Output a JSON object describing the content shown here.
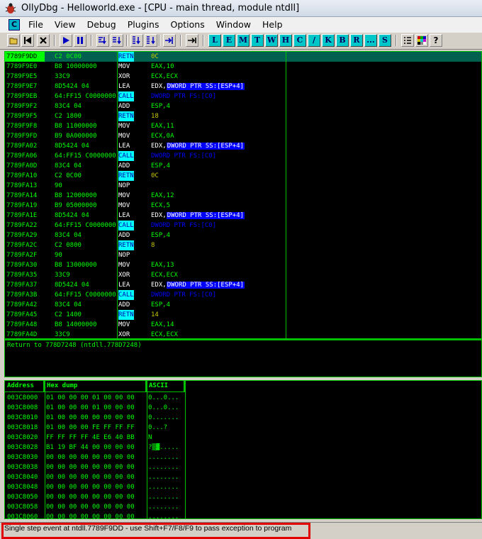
{
  "window": {
    "title": "OllyDbg - Helloworld.exe - [CPU - main thread, module ntdll]"
  },
  "menu": {
    "system_icon_label": "C",
    "items": [
      "File",
      "View",
      "Debug",
      "Plugins",
      "Options",
      "Window",
      "Help"
    ]
  },
  "toolbar": {
    "control_buttons": [
      "open-icon",
      "restart-icon",
      "close-icon"
    ],
    "run_buttons": [
      "run-icon",
      "pause-icon"
    ],
    "step_buttons": [
      "step-into-icon",
      "step-over-icon",
      "trace-into-icon",
      "trace-over-icon",
      "execute-till-return-icon"
    ],
    "goto_button": "goto-icon",
    "window_letters": [
      "L",
      "E",
      "M",
      "T",
      "W",
      "H",
      "C",
      "/",
      "K",
      "B",
      "R",
      "...",
      "S"
    ],
    "right_buttons": [
      "list-icon",
      "colors-icon",
      "help-icon"
    ]
  },
  "disassembly": {
    "rows": [
      {
        "addr": "7789F9DD",
        "hex": "C2 0C00",
        "mn": "RETN",
        "op": "0C",
        "style": "ret",
        "selected": true
      },
      {
        "addr": "7789F9E0",
        "hex": "B8 10000000",
        "mn": "MOV",
        "op": "EAX,10",
        "style": "plain"
      },
      {
        "addr": "7789F9E5",
        "hex": "33C9",
        "mn": "XOR",
        "op": "ECX,ECX",
        "style": "plain"
      },
      {
        "addr": "7789F9E7",
        "hex": "8D5424 04",
        "mn": "LEA",
        "op_pre": "EDX,",
        "op_box": "DWORD PTR SS:[ESP+4]",
        "style": "lea"
      },
      {
        "addr": "7789F9EB",
        "hex": "64:FF15 C0000000",
        "mn": "CALL",
        "op": "DWORD PTR FS:[C0]",
        "style": "call"
      },
      {
        "addr": "7789F9F2",
        "hex": "83C4 04",
        "mn": "ADD",
        "op": "ESP,4",
        "style": "plain"
      },
      {
        "addr": "7789F9F5",
        "hex": "C2 1800",
        "mn": "RETN",
        "op": "18",
        "style": "ret"
      },
      {
        "addr": "7789F9F8",
        "hex": "B8 11000000",
        "mn": "MOV",
        "op": "EAX,11",
        "style": "plain"
      },
      {
        "addr": "7789F9FD",
        "hex": "B9 0A000000",
        "mn": "MOV",
        "op": "ECX,0A",
        "style": "plain"
      },
      {
        "addr": "7789FA02",
        "hex": "8D5424 04",
        "mn": "LEA",
        "op_pre": "EDX,",
        "op_box": "DWORD PTR SS:[ESP+4]",
        "style": "lea"
      },
      {
        "addr": "7789FA06",
        "hex": "64:FF15 C0000000",
        "mn": "CALL",
        "op": "DWORD PTR FS:[C0]",
        "style": "call"
      },
      {
        "addr": "7789FA0D",
        "hex": "83C4 04",
        "mn": "ADD",
        "op": "ESP,4",
        "style": "plain"
      },
      {
        "addr": "7789FA10",
        "hex": "C2 0C00",
        "mn": "RETN",
        "op": "0C",
        "style": "ret"
      },
      {
        "addr": "7789FA13",
        "hex": "90",
        "mn": "NOP",
        "op": "",
        "style": "plain"
      },
      {
        "addr": "7789FA14",
        "hex": "B8 12000000",
        "mn": "MOV",
        "op": "EAX,12",
        "style": "plain"
      },
      {
        "addr": "7789FA19",
        "hex": "B9 05000000",
        "mn": "MOV",
        "op": "ECX,5",
        "style": "plain"
      },
      {
        "addr": "7789FA1E",
        "hex": "8D5424 04",
        "mn": "LEA",
        "op_pre": "EDX,",
        "op_box": "DWORD PTR SS:[ESP+4]",
        "style": "lea"
      },
      {
        "addr": "7789FA22",
        "hex": "64:FF15 C0000000",
        "mn": "CALL",
        "op": "DWORD PTR FS:[C0]",
        "style": "call"
      },
      {
        "addr": "7789FA29",
        "hex": "83C4 04",
        "mn": "ADD",
        "op": "ESP,4",
        "style": "plain"
      },
      {
        "addr": "7789FA2C",
        "hex": "C2 0800",
        "mn": "RETN",
        "op": "8",
        "style": "ret"
      },
      {
        "addr": "7789FA2F",
        "hex": "90",
        "mn": "NOP",
        "op": "",
        "style": "plain"
      },
      {
        "addr": "7789FA30",
        "hex": "B8 13000000",
        "mn": "MOV",
        "op": "EAX,13",
        "style": "plain"
      },
      {
        "addr": "7789FA35",
        "hex": "33C9",
        "mn": "XOR",
        "op": "ECX,ECX",
        "style": "plain"
      },
      {
        "addr": "7789FA37",
        "hex": "8D5424 04",
        "mn": "LEA",
        "op_pre": "EDX,",
        "op_box": "DWORD PTR SS:[ESP+4]",
        "style": "lea"
      },
      {
        "addr": "7789FA3B",
        "hex": "64:FF15 C0000000",
        "mn": "CALL",
        "op": "DWORD PTR FS:[C0]",
        "style": "call"
      },
      {
        "addr": "7789FA42",
        "hex": "83C4 04",
        "mn": "ADD",
        "op": "ESP,4",
        "style": "plain"
      },
      {
        "addr": "7789FA45",
        "hex": "C2 1400",
        "mn": "RETN",
        "op": "14",
        "style": "ret"
      },
      {
        "addr": "7789FA48",
        "hex": "B8 14000000",
        "mn": "MOV",
        "op": "EAX,14",
        "style": "plain"
      },
      {
        "addr": "7789FA4D",
        "hex": "33C9",
        "mn": "XOR",
        "op": "ECX,ECX",
        "style": "plain"
      }
    ]
  },
  "info": {
    "text": "Return to 778D7248 (ntdll.778D7248)"
  },
  "dump": {
    "headers": {
      "address": "Address",
      "hex": "Hex dump",
      "ascii": "ASCII"
    },
    "rows": [
      {
        "addr": "003C8000",
        "hex": "01 00 00 00 01 00 00 00",
        "ascii": "0...0..."
      },
      {
        "addr": "003C8008",
        "hex": "01 00 00 00 01 00 00 00",
        "ascii": "0...0..."
      },
      {
        "addr": "003C8010",
        "hex": "01 00 00 00 00 00 00 00",
        "ascii": "0......."
      },
      {
        "addr": "003C8018",
        "hex": "01 00 00 00 FE FF FF FF",
        "ascii": "0...?"
      },
      {
        "addr": "003C8020",
        "hex": "FF FF FF FF 4E E6 40 BB",
        "ascii": "     N"
      },
      {
        "addr": "003C8028",
        "hex": "B1 19 BF 44 00 00 00 00",
        "ascii": "?▒▓....."
      },
      {
        "addr": "003C8030",
        "hex": "00 00 00 00 00 00 00 00",
        "ascii": "........"
      },
      {
        "addr": "003C8038",
        "hex": "00 00 00 00 00 00 00 00",
        "ascii": "........"
      },
      {
        "addr": "003C8040",
        "hex": "00 00 00 00 00 00 00 00",
        "ascii": "........"
      },
      {
        "addr": "003C8048",
        "hex": "00 00 00 00 00 00 00 00",
        "ascii": "........"
      },
      {
        "addr": "003C8050",
        "hex": "00 00 00 00 00 00 00 00",
        "ascii": "........"
      },
      {
        "addr": "003C8058",
        "hex": "00 00 00 00 00 00 00 00",
        "ascii": "........"
      },
      {
        "addr": "003C8060",
        "hex": "00 00 00 00 00 00 00 00",
        "ascii": "........"
      }
    ]
  },
  "status": {
    "text": "Single step event at ntdll.7789F9DD - use Shift+F7/F8/F9 to pass exception to program",
    "highlight_color": "#e00000"
  },
  "colors": {
    "pane_bg": "#000000",
    "text_green": "#00ff00",
    "call_highlight": "#00ffff",
    "operand_box": "#0000ff"
  }
}
